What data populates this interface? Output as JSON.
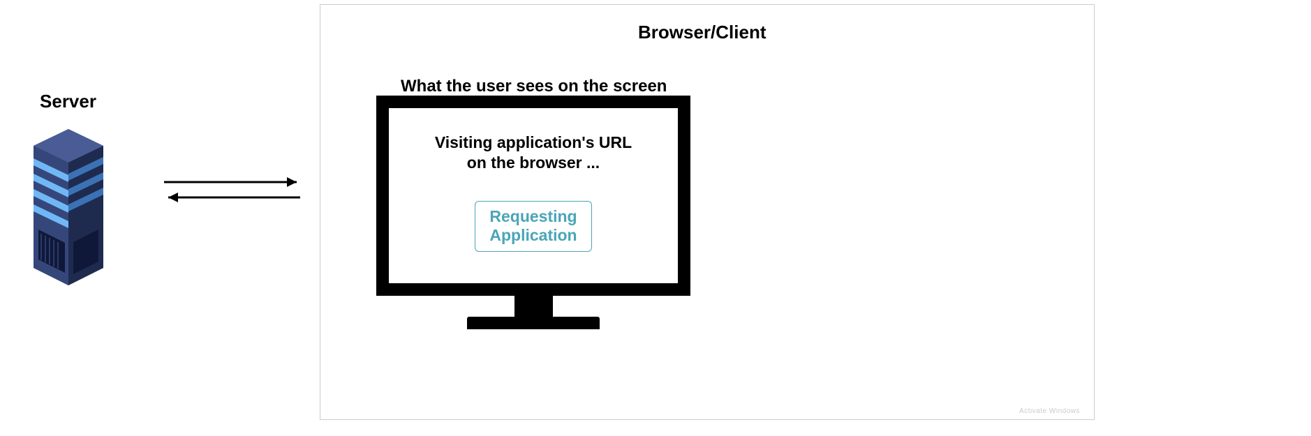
{
  "server": {
    "label": "Server"
  },
  "browser": {
    "label": "Browser/Client",
    "screen_caption": "What the user sees on the screen",
    "screen_text_line1": "Visiting application's URL",
    "screen_text_line2": "on the browser ...",
    "request_line1": "Requesting",
    "request_line2": "Application"
  },
  "watermark": "Activate Windows"
}
